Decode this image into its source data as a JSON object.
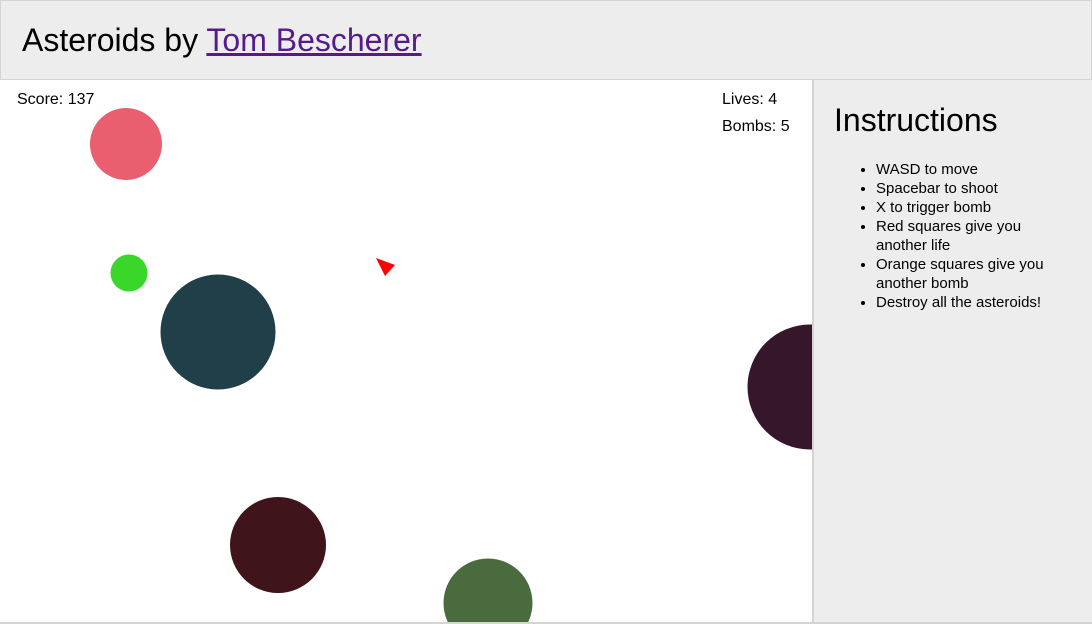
{
  "header": {
    "title_prefix": "Asteroids by ",
    "author_link": "Tom Bescherer",
    "link_color": "#551a8b"
  },
  "hud": {
    "score_label": "Score: 137",
    "lives_label": "Lives: 4",
    "bombs_label": "Bombs: 5"
  },
  "game": {
    "ship_color": "#ff0000",
    "asteroids": [
      {
        "name": "asteroid-pink",
        "color": "#e95f70"
      },
      {
        "name": "asteroid-small-green",
        "color": "#3ad62a"
      },
      {
        "name": "asteroid-dark-teal",
        "color": "#203f48"
      },
      {
        "name": "asteroid-dark-purple",
        "color": "#36162b"
      },
      {
        "name": "asteroid-dark-maroon",
        "color": "#40141b"
      },
      {
        "name": "asteroid-olive-green",
        "color": "#4a6b3e"
      }
    ]
  },
  "sidebar": {
    "title": "Instructions",
    "items": [
      "WASD to move",
      "Spacebar to shoot",
      "X to trigger bomb",
      "Red squares give you another life",
      "Orange squares give you another bomb",
      "Destroy all the asteroids!"
    ]
  }
}
